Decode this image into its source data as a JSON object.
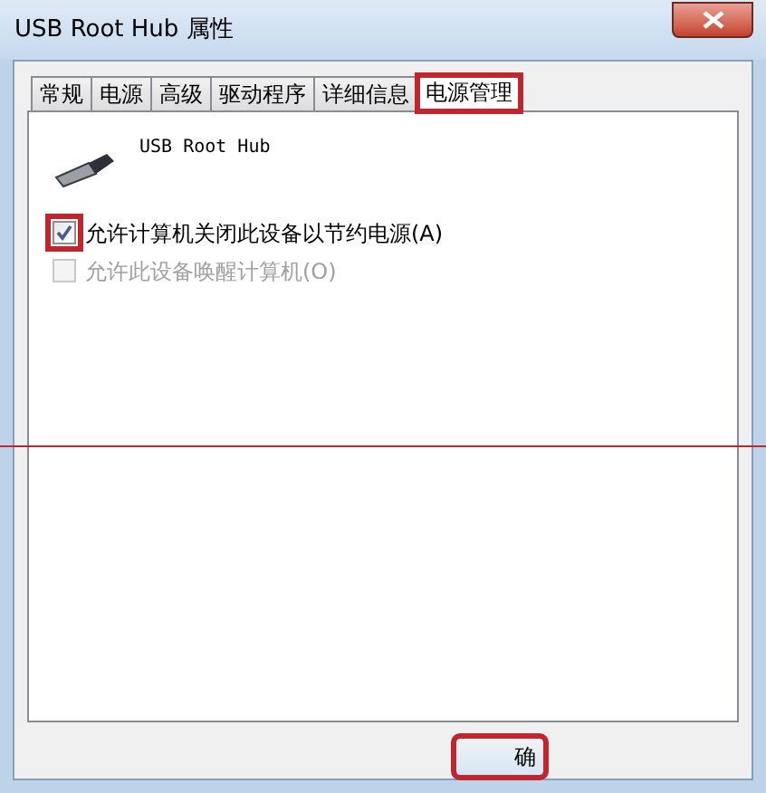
{
  "window": {
    "title": "USB Root Hub 属性"
  },
  "tabs": [
    {
      "label": "常规",
      "selected": false,
      "highlighted": false
    },
    {
      "label": "电源",
      "selected": false,
      "highlighted": false
    },
    {
      "label": "高级",
      "selected": false,
      "highlighted": false
    },
    {
      "label": "驱动程序",
      "selected": false,
      "highlighted": false
    },
    {
      "label": "详细信息",
      "selected": false,
      "highlighted": false
    },
    {
      "label": "电源管理",
      "selected": true,
      "highlighted": true
    }
  ],
  "device": {
    "name": "USB Root Hub"
  },
  "options": [
    {
      "label": "允许计算机关闭此设备以节约电源(A)",
      "checked": true,
      "disabled": false,
      "highlighted": true
    },
    {
      "label": "允许此设备唤醒计算机(O)",
      "checked": false,
      "disabled": true,
      "highlighted": false
    }
  ],
  "buttons": [
    {
      "label": "确",
      "highlighted": true
    }
  ]
}
